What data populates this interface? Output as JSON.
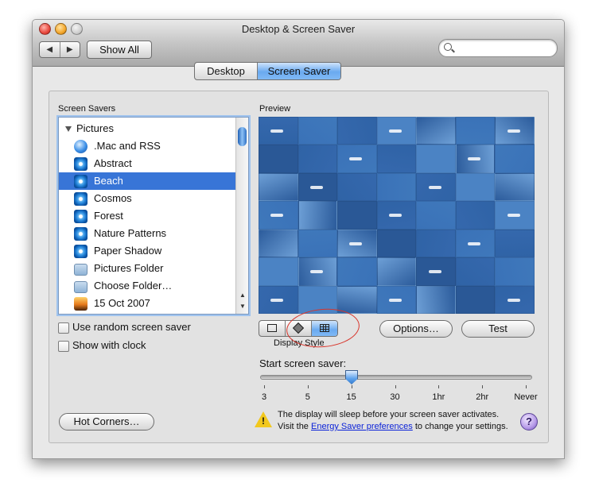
{
  "window": {
    "title": "Desktop & Screen Saver"
  },
  "toolbar": {
    "back": "◀",
    "forward": "▶",
    "show_all": "Show All",
    "search_placeholder": ""
  },
  "tabs": [
    {
      "label": "Desktop"
    },
    {
      "label": "Screen Saver",
      "selected": true
    }
  ],
  "screen_savers": {
    "label": "Screen Savers",
    "group": "Pictures",
    "items": [
      {
        "label": ".Mac and RSS",
        "icon": "mac-globe-icon"
      },
      {
        "label": "Abstract",
        "icon": "swirl-icon"
      },
      {
        "label": "Beach",
        "icon": "swirl-icon",
        "selected": true
      },
      {
        "label": "Cosmos",
        "icon": "swirl-icon"
      },
      {
        "label": "Forest",
        "icon": "swirl-icon"
      },
      {
        "label": "Nature Patterns",
        "icon": "swirl-icon"
      },
      {
        "label": "Paper Shadow",
        "icon": "swirl-icon"
      },
      {
        "label": "Pictures Folder",
        "icon": "folder-icon"
      },
      {
        "label": "Choose Folder…",
        "icon": "folder-icon"
      },
      {
        "label": "15 Oct 2007",
        "icon": "photo-icon"
      }
    ]
  },
  "options": {
    "random": {
      "label": "Use random screen saver",
      "checked": false
    },
    "clock": {
      "label": "Show with clock",
      "checked": false
    }
  },
  "preview": {
    "label": "Preview"
  },
  "display_style": {
    "label": "Display Style",
    "selected": "mosaic",
    "styles": [
      "slideshow",
      "collage",
      "mosaic"
    ]
  },
  "buttons": {
    "options": "Options…",
    "test": "Test",
    "hot_corners": "Hot Corners…"
  },
  "start": {
    "label": "Start screen saver:",
    "value": "15",
    "ticks": [
      "3",
      "5",
      "15",
      "30",
      "1hr",
      "2hr",
      "Never"
    ]
  },
  "warning": {
    "line1": "The display will sleep before your screen saver activates.",
    "line2_pre": "Visit the ",
    "link": "Energy Saver preferences",
    "line2_post": " to change your settings."
  },
  "help": "?",
  "colors": {
    "selection": "#3875d7",
    "accent": "#6aaaf0",
    "annotation_ring": "#d8352b",
    "link": "#0b22d8"
  }
}
